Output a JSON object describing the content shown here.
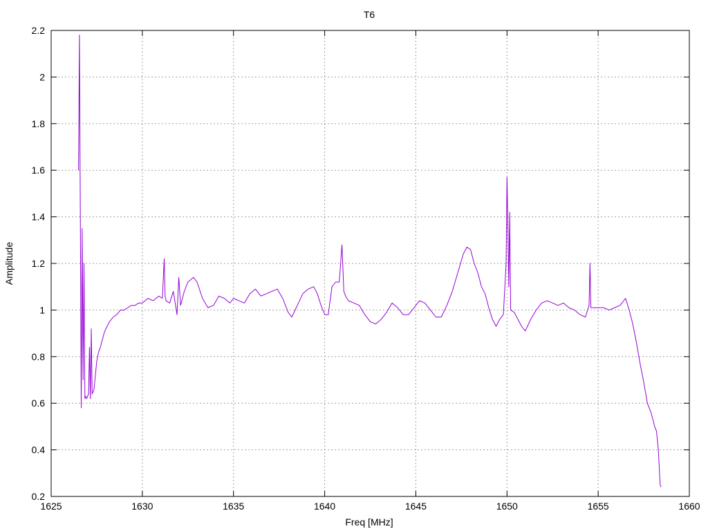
{
  "chart_data": {
    "type": "line",
    "title": "T6",
    "xlabel": "Freq [MHz]",
    "ylabel": "Amplitude",
    "xlim": [
      1625,
      1660
    ],
    "ylim": [
      0.2,
      2.2
    ],
    "grid": true,
    "legend": "none",
    "x_ticks": [
      "1625",
      "1630",
      "1635",
      "1640",
      "1645",
      "1650",
      "1655",
      "1660"
    ],
    "y_ticks": [
      "0.2",
      "0.4",
      "0.6",
      "0.8",
      "1",
      "1.2",
      "1.4",
      "1.6",
      "1.8",
      "2",
      "2.2"
    ],
    "series": [
      {
        "color": "#9400d3",
        "x": [
          1626.5,
          1626.55,
          1626.6,
          1626.65,
          1626.7,
          1626.75,
          1626.8,
          1626.85,
          1626.9,
          1626.95,
          1627.0,
          1627.05,
          1627.1,
          1627.15,
          1627.2,
          1627.25,
          1627.3,
          1627.35,
          1627.4,
          1627.5,
          1627.6,
          1627.7,
          1627.8,
          1627.9,
          1628.0,
          1628.2,
          1628.4,
          1628.6,
          1628.8,
          1629.0,
          1629.2,
          1629.4,
          1629.6,
          1629.8,
          1630.0,
          1630.3,
          1630.6,
          1630.9,
          1631.1,
          1631.2,
          1631.25,
          1631.3,
          1631.5,
          1631.7,
          1631.9,
          1632.0,
          1632.1,
          1632.3,
          1632.5,
          1632.8,
          1633.0,
          1633.3,
          1633.6,
          1633.9,
          1634.2,
          1634.5,
          1634.8,
          1635.0,
          1635.3,
          1635.6,
          1635.9,
          1636.2,
          1636.5,
          1636.8,
          1637.1,
          1637.4,
          1637.7,
          1638.0,
          1638.2,
          1638.5,
          1638.8,
          1639.1,
          1639.4,
          1639.6,
          1639.8,
          1640.0,
          1640.2,
          1640.4,
          1640.6,
          1640.8,
          1640.95,
          1641.05,
          1641.15,
          1641.3,
          1641.6,
          1641.9,
          1642.2,
          1642.5,
          1642.8,
          1643.1,
          1643.4,
          1643.7,
          1644.0,
          1644.3,
          1644.6,
          1644.9,
          1645.2,
          1645.5,
          1645.8,
          1646.1,
          1646.4,
          1646.7,
          1647.0,
          1647.3,
          1647.6,
          1647.8,
          1648.0,
          1648.2,
          1648.4,
          1648.6,
          1648.8,
          1649.0,
          1649.2,
          1649.4,
          1649.6,
          1649.8,
          1649.95,
          1650.0,
          1650.05,
          1650.1,
          1650.15,
          1650.2,
          1650.4,
          1650.6,
          1650.8,
          1651.0,
          1651.3,
          1651.6,
          1651.9,
          1652.2,
          1652.5,
          1652.8,
          1653.1,
          1653.4,
          1653.7,
          1654.0,
          1654.3,
          1654.5,
          1654.55,
          1654.6,
          1654.8,
          1655.0,
          1655.3,
          1655.6,
          1655.9,
          1656.2,
          1656.5,
          1656.7,
          1656.9,
          1657.1,
          1657.3,
          1657.5,
          1657.7,
          1657.9,
          1658.1,
          1658.2,
          1658.3,
          1658.4,
          1658.45
        ],
        "y": [
          1.6,
          2.18,
          1.4,
          0.58,
          1.35,
          0.7,
          1.2,
          0.62,
          0.63,
          0.62,
          0.63,
          0.64,
          0.84,
          0.62,
          0.92,
          0.64,
          0.65,
          0.66,
          0.7,
          0.78,
          0.82,
          0.84,
          0.87,
          0.9,
          0.92,
          0.95,
          0.97,
          0.98,
          1.0,
          1.0,
          1.01,
          1.02,
          1.02,
          1.03,
          1.03,
          1.05,
          1.04,
          1.06,
          1.05,
          1.22,
          1.06,
          1.04,
          1.03,
          1.08,
          0.98,
          1.14,
          1.02,
          1.08,
          1.12,
          1.14,
          1.12,
          1.05,
          1.01,
          1.02,
          1.06,
          1.05,
          1.03,
          1.05,
          1.04,
          1.03,
          1.07,
          1.09,
          1.06,
          1.07,
          1.08,
          1.09,
          1.05,
          0.99,
          0.97,
          1.02,
          1.07,
          1.09,
          1.1,
          1.07,
          1.02,
          0.98,
          0.98,
          1.1,
          1.12,
          1.12,
          1.28,
          1.08,
          1.06,
          1.04,
          1.03,
          1.02,
          0.98,
          0.95,
          0.94,
          0.96,
          0.99,
          1.03,
          1.01,
          0.98,
          0.98,
          1.01,
          1.04,
          1.03,
          1.0,
          0.97,
          0.97,
          1.02,
          1.08,
          1.16,
          1.24,
          1.27,
          1.26,
          1.2,
          1.16,
          1.1,
          1.07,
          1.01,
          0.96,
          0.93,
          0.96,
          0.98,
          1.2,
          1.57,
          1.35,
          1.1,
          1.42,
          1.0,
          0.99,
          0.96,
          0.93,
          0.91,
          0.96,
          1.0,
          1.03,
          1.04,
          1.03,
          1.02,
          1.03,
          1.01,
          1.0,
          0.98,
          0.97,
          1.02,
          1.2,
          1.01,
          1.01,
          1.01,
          1.01,
          1.0,
          1.01,
          1.02,
          1.05,
          1.0,
          0.94,
          0.86,
          0.77,
          0.69,
          0.6,
          0.56,
          0.5,
          0.48,
          0.4,
          0.25,
          0.24
        ]
      }
    ]
  }
}
